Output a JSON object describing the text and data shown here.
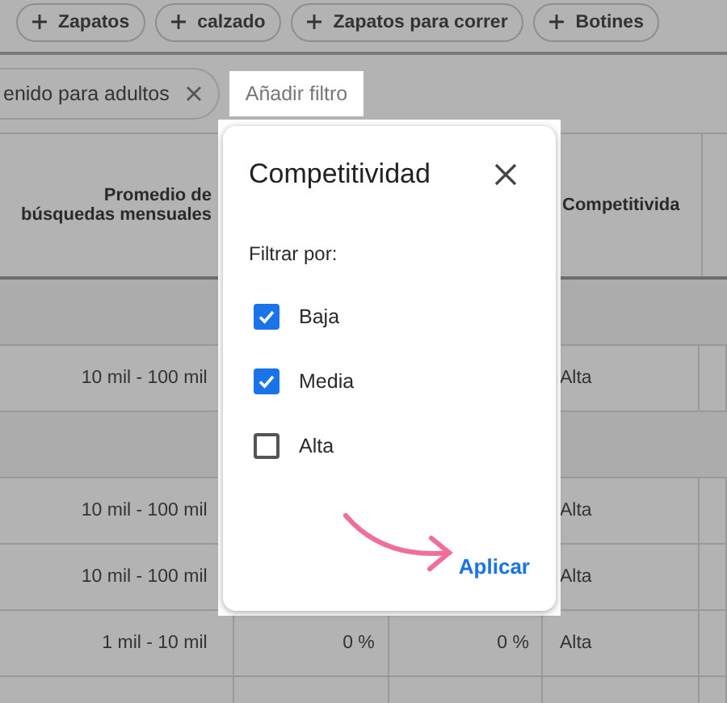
{
  "top_chips": [
    "Zapatos",
    "calzado",
    "Zapatos para correr",
    "Botines"
  ],
  "filter_bar": {
    "active_filter": "enido para adultos",
    "add_filter": "Añadir filtro"
  },
  "table": {
    "columns": [
      "Promedio de búsquedas mensuales",
      "",
      "",
      "Competitivida"
    ],
    "rows": [
      {
        "kind": "group",
        "cells": []
      },
      {
        "kind": "data",
        "cells": [
          "10 mil - 100 mil",
          "",
          "",
          "Alta"
        ]
      },
      {
        "kind": "group",
        "cells": []
      },
      {
        "kind": "data",
        "cells": [
          "10 mil - 100 mil",
          "",
          "",
          "Alta"
        ]
      },
      {
        "kind": "data",
        "cells": [
          "10 mil - 100 mil",
          "",
          "",
          "Alta"
        ]
      },
      {
        "kind": "data",
        "cells": [
          "1 mil - 10 mil",
          "0 %",
          "0 %",
          "Alta"
        ]
      },
      {
        "kind": "data",
        "cells": [
          "",
          "",
          "",
          ""
        ]
      }
    ]
  },
  "dialog": {
    "title": "Competitividad",
    "subtitle": "Filtrar por:",
    "options": [
      {
        "label": "Baja",
        "checked": true
      },
      {
        "label": "Media",
        "checked": true
      },
      {
        "label": "Alta",
        "checked": false
      }
    ],
    "apply": "Aplicar"
  }
}
